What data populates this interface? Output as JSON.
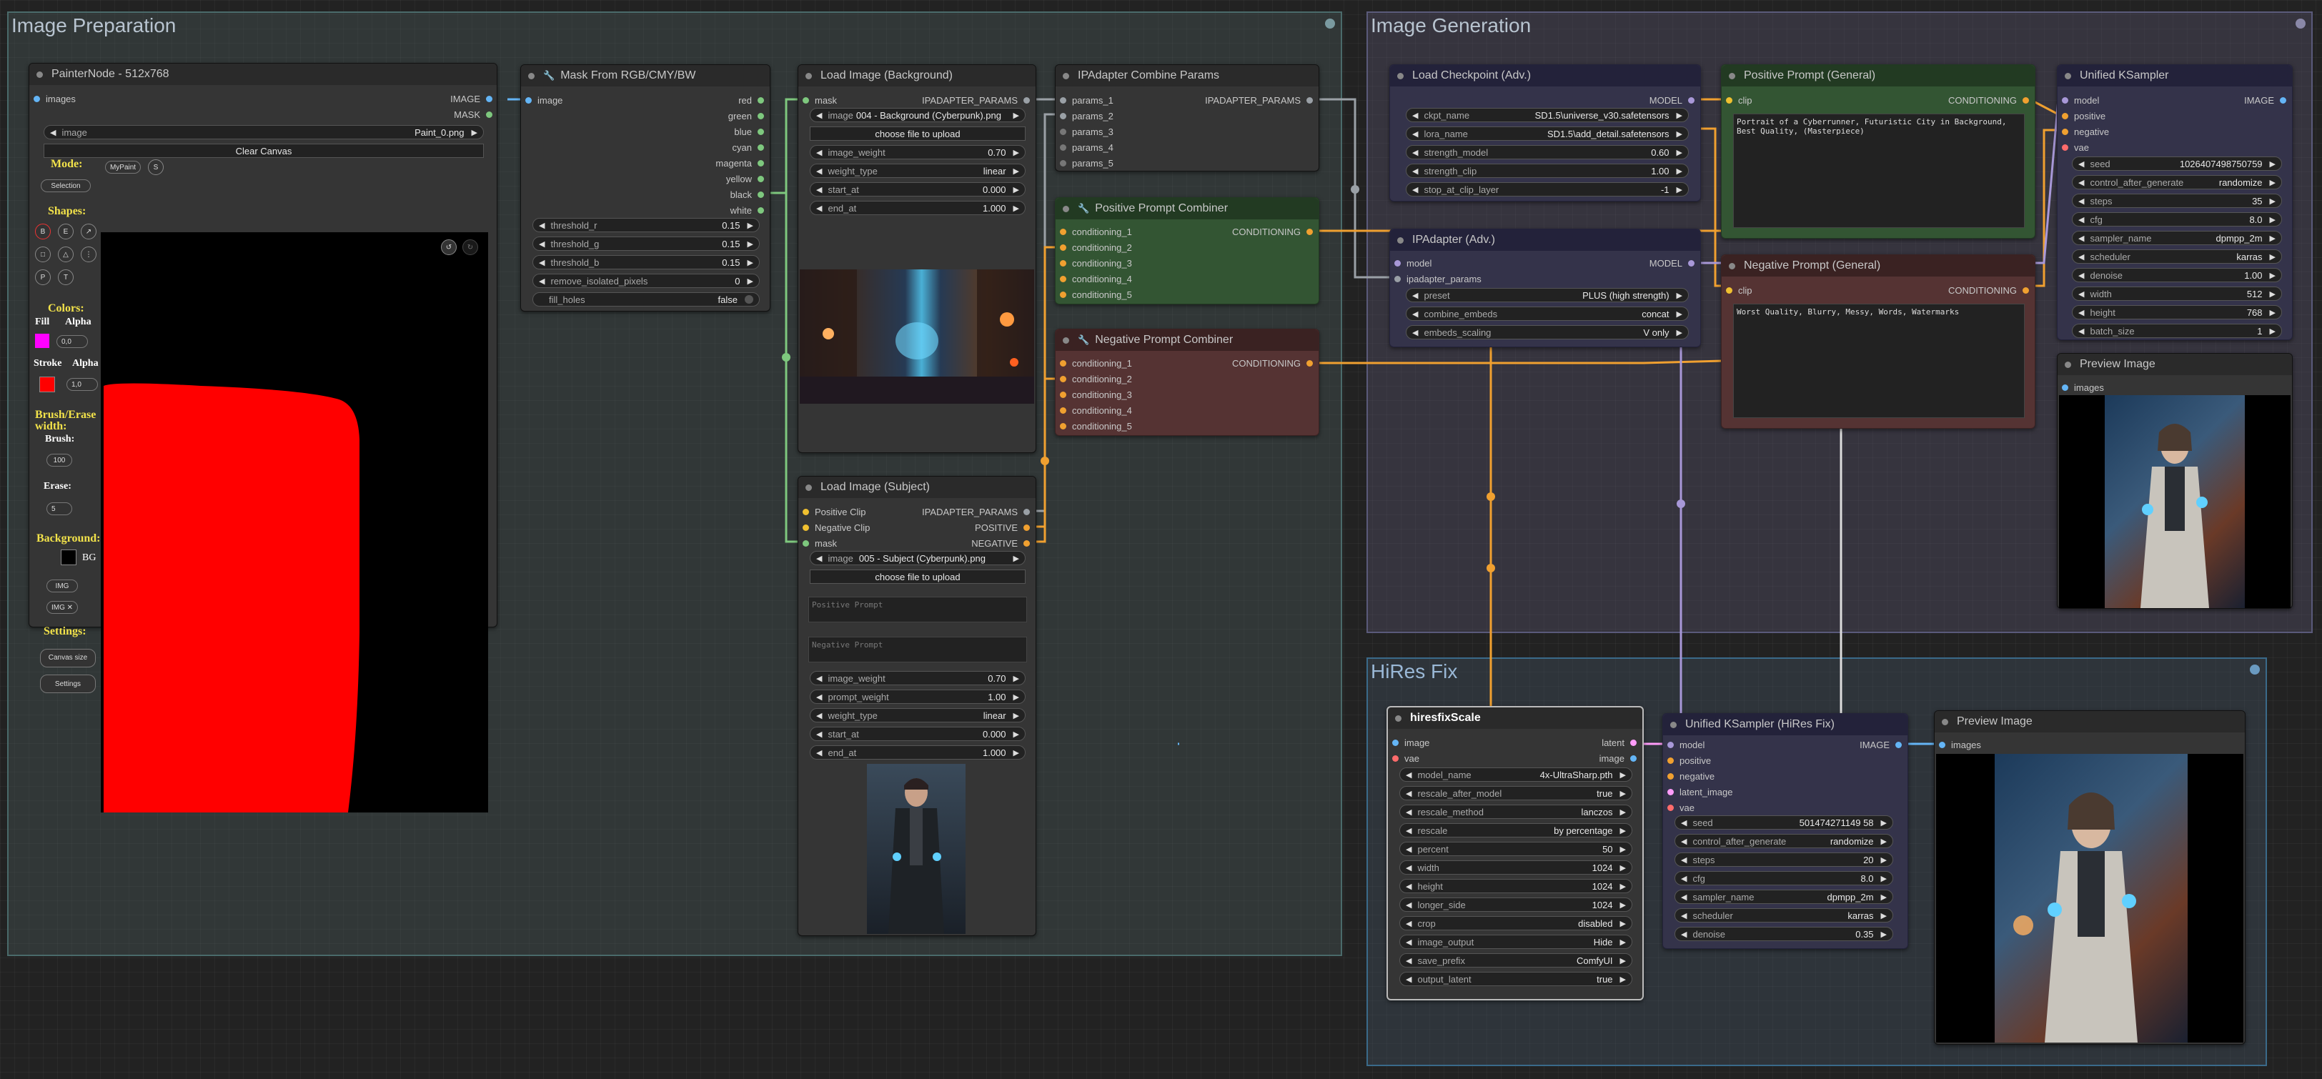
{
  "groups": {
    "prep": {
      "title": "Image Preparation"
    },
    "gen": {
      "title": "Image Generation"
    },
    "hires": {
      "title": "HiRes Fix"
    }
  },
  "painter": {
    "title": "PainterNode - 512x768",
    "in_images": "images",
    "out_image": "IMAGE",
    "out_mask": "MASK",
    "image_widget": {
      "name": "image",
      "value": "Paint_0.png"
    },
    "clear_button": "Clear Canvas",
    "mode_label": "Mode:",
    "mypaint_btn": "MyPaint",
    "s_btn": "S",
    "selection_btn": "Selection",
    "shapes_label": "Shapes:",
    "shape_buttons": [
      "B",
      "E",
      "↗",
      "",
      "",
      "",
      "P",
      "T"
    ],
    "colors_label": "Colors:",
    "fill_label": "Fill",
    "alpha_label": "Alpha",
    "fill_alpha": "0,0",
    "stroke_label": "Stroke",
    "alpha_label2": "Alpha",
    "stroke_alpha": "1,0",
    "brush_erase_label": "Brush/Erase width:",
    "brush_label": "Brush:",
    "brush_value": "100",
    "erase_label": "Erase:",
    "erase_value": "5",
    "background_label": "Background:",
    "bg_text": "BG",
    "img_btn": "IMG",
    "img_x_btn": "IMG ✕",
    "settings_label": "Settings:",
    "canvas_size_btn": "Canvas size",
    "settings_btn": "Settings",
    "fill_color": "#ff00ff",
    "stroke_color": "#ff0000"
  },
  "mask": {
    "title": "Mask From RGB/CMY/BW",
    "in_image": "image",
    "outputs": [
      "red",
      "green",
      "blue",
      "cyan",
      "magenta",
      "yellow",
      "black",
      "white"
    ],
    "widgets": [
      {
        "name": "threshold_r",
        "value": "0.15"
      },
      {
        "name": "threshold_g",
        "value": "0.15"
      },
      {
        "name": "threshold_b",
        "value": "0.15"
      },
      {
        "name": "remove_isolated_pixels",
        "value": "0"
      }
    ],
    "fill_holes": {
      "name": "fill_holes",
      "value": "false"
    }
  },
  "load_bg": {
    "title": "Load Image (Background)",
    "in_mask": "mask",
    "out_params": "IPADAPTER_PARAMS",
    "image_widget": {
      "name": "image",
      "value": "004 - Background (Cyberpunk).png"
    },
    "upload": "choose file to upload",
    "widgets": [
      {
        "name": "image_weight",
        "value": "0.70"
      },
      {
        "name": "weight_type",
        "value": "linear"
      },
      {
        "name": "start_at",
        "value": "0.000"
      },
      {
        "name": "end_at",
        "value": "1.000"
      }
    ]
  },
  "load_subject": {
    "title": "Load Image (Subject)",
    "inputs": [
      "Positive Clip",
      "Negative Clip",
      "mask"
    ],
    "outputs": [
      "IPADAPTER_PARAMS",
      "POSITIVE",
      "NEGATIVE"
    ],
    "image_widget": {
      "name": "image",
      "value": "005 - Subject (Cyberpunk).png"
    },
    "upload": "choose file to upload",
    "pos_placeholder": "Positive Prompt",
    "neg_placeholder": "Negative Prompt",
    "widgets": [
      {
        "name": "image_weight",
        "value": "0.70"
      },
      {
        "name": "prompt_weight",
        "value": "1.00"
      },
      {
        "name": "weight_type",
        "value": "linear"
      },
      {
        "name": "start_at",
        "value": "0.000"
      },
      {
        "name": "end_at",
        "value": "1.000"
      }
    ]
  },
  "combine": {
    "title": "IPAdapter Combine Params",
    "inputs": [
      "params_1",
      "params_2",
      "params_3",
      "params_4",
      "params_5"
    ],
    "out": "IPADAPTER_PARAMS"
  },
  "pos_combiner": {
    "title": "Positive Prompt Combiner",
    "inputs": [
      "conditioning_1",
      "conditioning_2",
      "conditioning_3",
      "conditioning_4",
      "conditioning_5"
    ],
    "out": "CONDITIONING"
  },
  "neg_combiner": {
    "title": "Negative Prompt Combiner",
    "inputs": [
      "conditioning_1",
      "conditioning_2",
      "conditioning_3",
      "conditioning_4",
      "conditioning_5"
    ],
    "out": "CONDITIONING"
  },
  "checkpoint": {
    "title": "Load Checkpoint (Adv.)",
    "out": "MODEL",
    "widgets": [
      {
        "name": "ckpt_name",
        "value": "SD1.5\\universe_v30.safetensors"
      },
      {
        "name": "lora_name",
        "value": "SD1.5\\add_detail.safetensors"
      },
      {
        "name": "strength_model",
        "value": "0.60"
      },
      {
        "name": "strength_clip",
        "value": "1.00"
      },
      {
        "name": "stop_at_clip_layer",
        "value": "-1"
      }
    ]
  },
  "ipadapter": {
    "title": "IPAdapter (Adv.)",
    "inputs": [
      "model",
      "ipadapter_params"
    ],
    "out": "MODEL",
    "widgets": [
      {
        "name": "preset",
        "value": "PLUS (high strength)"
      },
      {
        "name": "combine_embeds",
        "value": "concat"
      },
      {
        "name": "embeds_scaling",
        "value": "V only"
      }
    ]
  },
  "pos_prompt": {
    "title": "Positive Prompt (General)",
    "in": "clip",
    "out": "CONDITIONING",
    "text": "Portrait of a Cyberrunner, Futuristic City in Background, Best Quality, (Masterpiece)"
  },
  "neg_prompt": {
    "title": "Negative Prompt (General)",
    "in": "clip",
    "out": "CONDITIONING",
    "text": "Worst Quality, Blurry, Messy, Words, Watermarks"
  },
  "ksampler": {
    "title": "Unified KSampler",
    "inputs": [
      "model",
      "positive",
      "negative",
      "vae"
    ],
    "out": "IMAGE",
    "widgets": [
      {
        "name": "seed",
        "value": "1026407498750759"
      },
      {
        "name": "control_after_generate",
        "value": "randomize"
      },
      {
        "name": "steps",
        "value": "35"
      },
      {
        "name": "cfg",
        "value": "8.0"
      },
      {
        "name": "sampler_name",
        "value": "dpmpp_2m"
      },
      {
        "name": "scheduler",
        "value": "karras"
      },
      {
        "name": "denoise",
        "value": "1.00"
      },
      {
        "name": "width",
        "value": "512"
      },
      {
        "name": "height",
        "value": "768"
      },
      {
        "name": "batch_size",
        "value": "1"
      }
    ]
  },
  "preview1": {
    "title": "Preview Image",
    "in": "images"
  },
  "hiresscale": {
    "title": "hiresfixScale",
    "inputs": [
      "image",
      "vae"
    ],
    "outputs": [
      "latent",
      "image"
    ],
    "widgets": [
      {
        "name": "model_name",
        "value": "4x-UltraSharp.pth"
      },
      {
        "name": "rescale_after_model",
        "value": "true"
      },
      {
        "name": "rescale_method",
        "value": "lanczos"
      },
      {
        "name": "rescale",
        "value": "by percentage"
      },
      {
        "name": "percent",
        "value": "50"
      },
      {
        "name": "width",
        "value": "1024"
      },
      {
        "name": "height",
        "value": "1024"
      },
      {
        "name": "longer_side",
        "value": "1024"
      },
      {
        "name": "crop",
        "value": "disabled"
      },
      {
        "name": "image_output",
        "value": "Hide"
      },
      {
        "name": "save_prefix",
        "value": "ComfyUI"
      },
      {
        "name": "output_latent",
        "value": "true"
      }
    ]
  },
  "ksampler_hires": {
    "title": "Unified KSampler (HiRes Fix)",
    "inputs": [
      "model",
      "positive",
      "negative",
      "latent_image",
      "vae"
    ],
    "out": "IMAGE",
    "widgets": [
      {
        "name": "seed",
        "value": "501474271149 58"
      },
      {
        "name": "control_after_generate",
        "value": "randomize"
      },
      {
        "name": "steps",
        "value": "20"
      },
      {
        "name": "cfg",
        "value": "8.0"
      },
      {
        "name": "sampler_name",
        "value": "dpmpp_2m"
      },
      {
        "name": "scheduler",
        "value": "karras"
      },
      {
        "name": "denoise",
        "value": "0.35"
      }
    ]
  },
  "preview2": {
    "title": "Preview Image",
    "in": "images"
  },
  "colors": {
    "link_green": "#7ec87e",
    "link_orange": "#f0a030",
    "link_lavender": "#a898d8",
    "link_gray": "#9aa0a6",
    "link_blue": "#64b5f6"
  }
}
